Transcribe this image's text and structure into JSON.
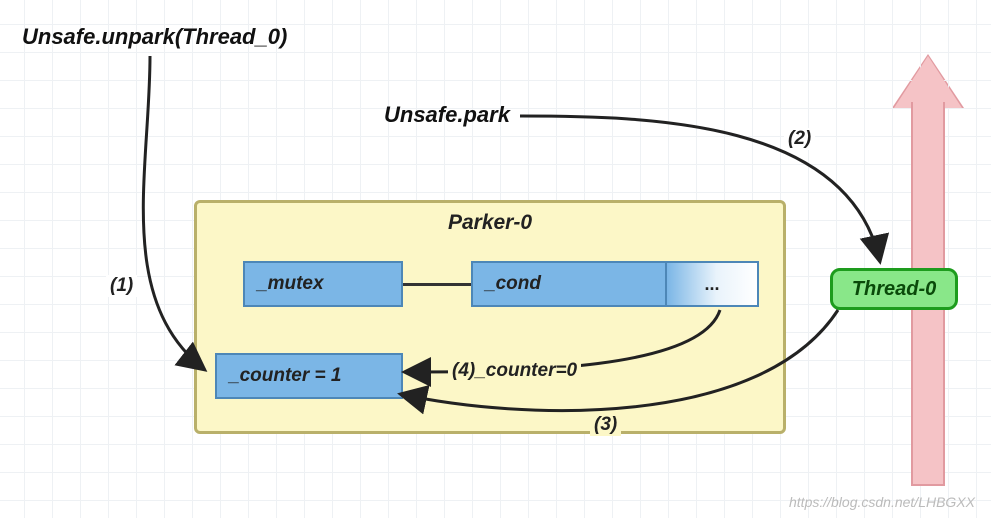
{
  "titles": {
    "unpark": "Unsafe.unpark(Thread_0)",
    "park": "Unsafe.park"
  },
  "parker": {
    "title": "Parker-0",
    "mutex": "_mutex",
    "cond": "_cond",
    "cond_ext": "...",
    "counter": "_counter = 1"
  },
  "thread": {
    "label": "Thread-0"
  },
  "edges": {
    "e1": "(1)",
    "e2": "(2)",
    "e3": "(3)",
    "e4": "(4)_counter=0"
  },
  "watermark": "https://blog.csdn.net/LHBGXX"
}
